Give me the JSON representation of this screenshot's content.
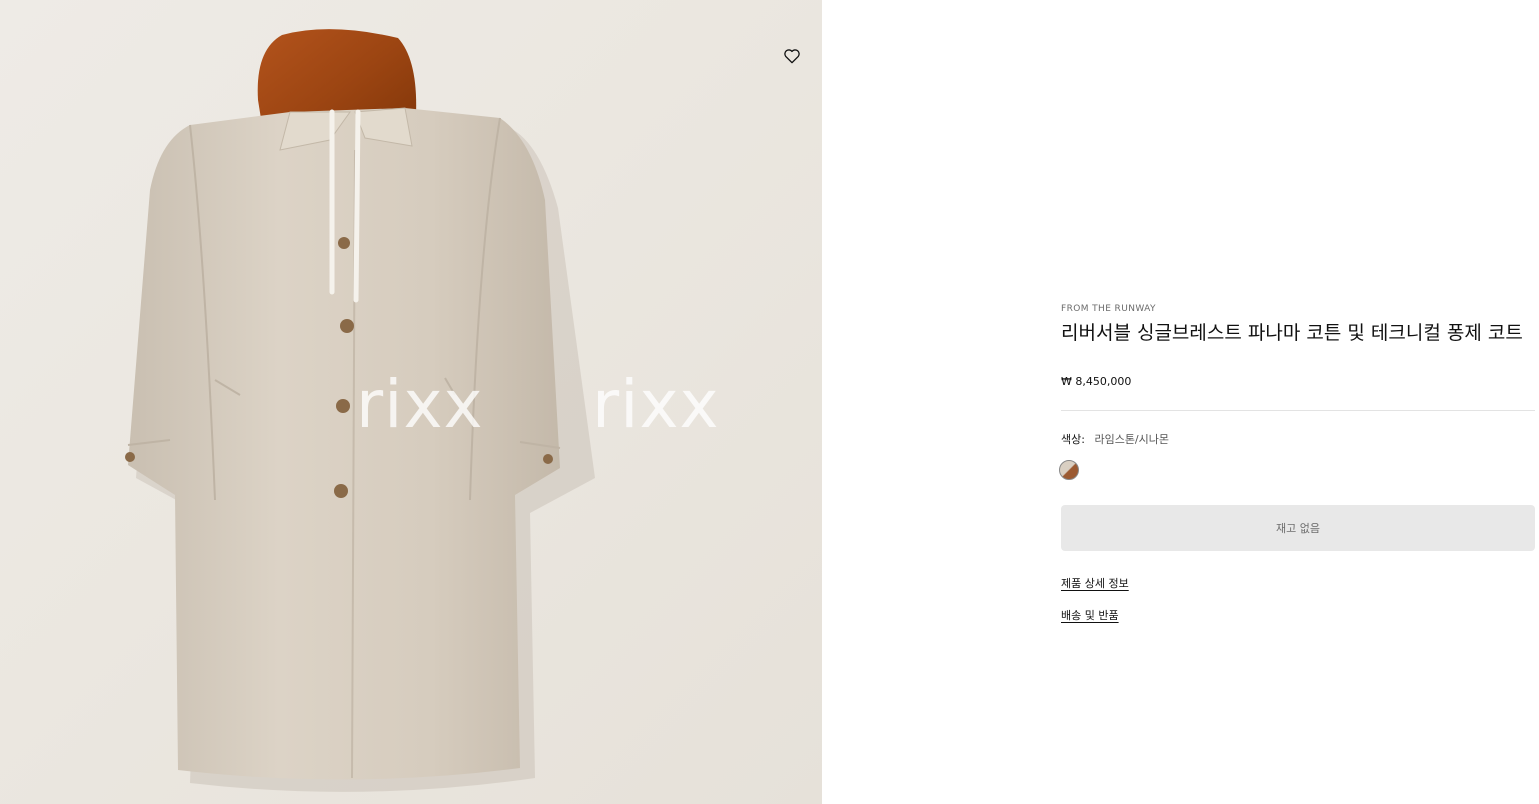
{
  "product_image": {
    "watermark_text": [
      "rixx",
      "rixx"
    ],
    "wishlist_icon": "heart-outline-icon"
  },
  "product": {
    "eyebrow": "FROM THE RUNWAY",
    "title": "리버서블 싱글브레스트 파나마 코튼 및 테크니컬 퐁제 코트",
    "price": "₩ 8,450,000",
    "color_label": "색상:",
    "color_value": "라임스톤/시나몬",
    "swatch_colors": [
      "#d9cfc2",
      "#9b5a32"
    ],
    "soldout_label": "재고 없음",
    "links": {
      "details": "제품 상세 정보",
      "shipping": "배송 및 반품"
    }
  }
}
